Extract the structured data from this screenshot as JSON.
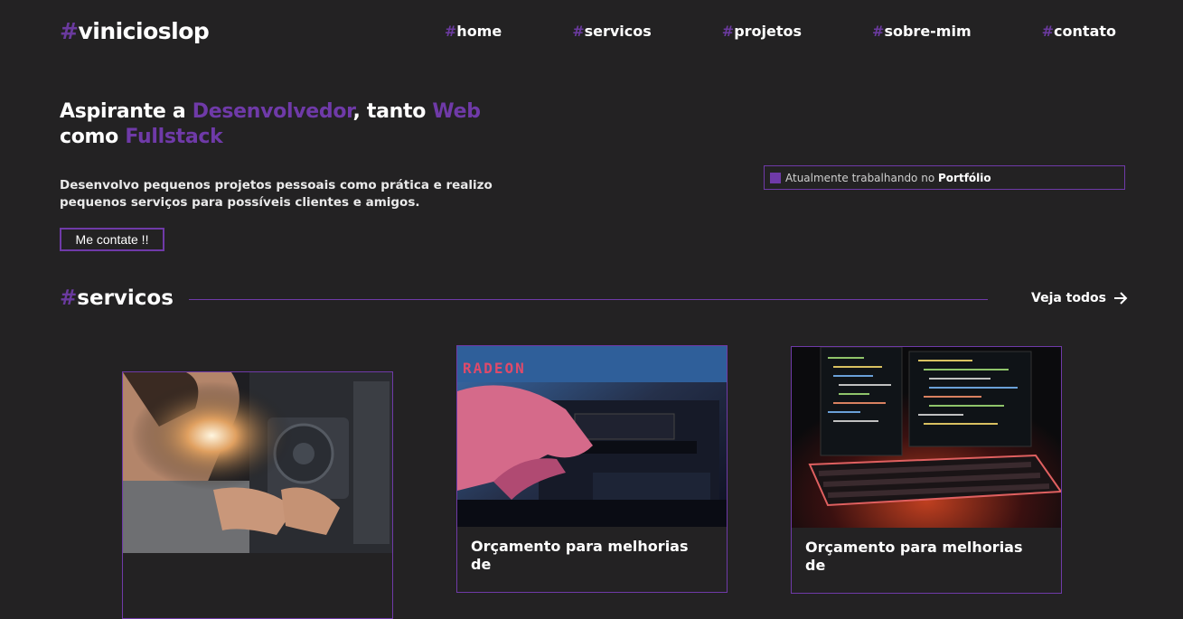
{
  "header": {
    "brand_hash": "#",
    "brand_name": "vinicioslop",
    "nav": [
      {
        "hash": "#",
        "label": "home"
      },
      {
        "hash": "#",
        "label": "servicos"
      },
      {
        "hash": "#",
        "label": "projetos"
      },
      {
        "hash": "#",
        "label": "sobre-mim"
      },
      {
        "hash": "#",
        "label": "contato"
      }
    ]
  },
  "hero": {
    "title_part1": "Aspirante a ",
    "title_highlight1": "Desenvolvedor",
    "title_part2": ", tanto ",
    "title_highlight2": "Web",
    "title_part3": " como ",
    "title_highlight3": "Fullstack",
    "description": "Desenvolvo pequenos projetos pessoais como prática e realizo pequenos serviços para possíveis clientes e amigos.",
    "button_label": "Me contate !!",
    "status_text": "Atualmente trabalhando no ",
    "status_project": "Portfólio"
  },
  "services": {
    "hash": "#",
    "title": "servicos",
    "see_all": "Veja todos",
    "cards": [
      {
        "title": ""
      },
      {
        "title": "Orçamento para melhorias de"
      },
      {
        "title": "Orçamento para melhorias de"
      }
    ]
  },
  "colors": {
    "background": "#232223",
    "accent": "#6f3aa8",
    "text": "#ffffff"
  }
}
